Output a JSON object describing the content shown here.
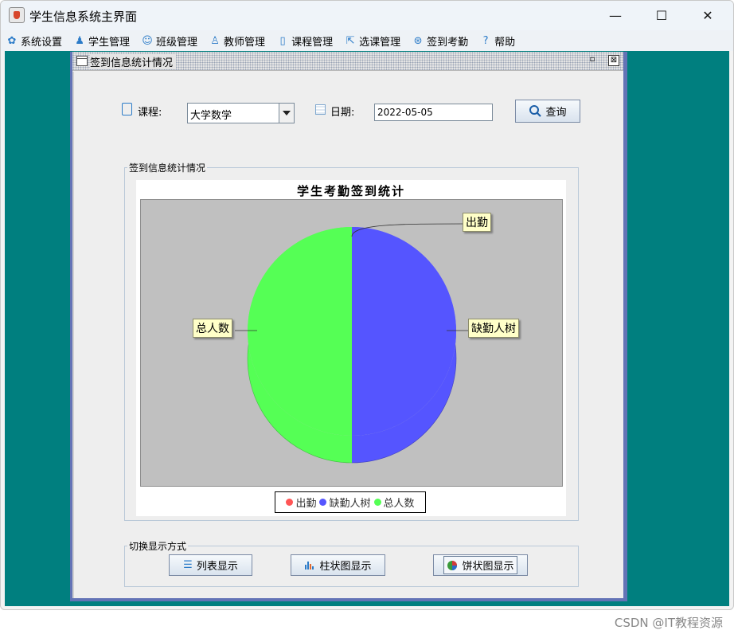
{
  "window": {
    "title": "学生信息系统主界面",
    "minimize_glyph": "—",
    "maximize_glyph": "☐",
    "close_glyph": "✕"
  },
  "menubar": {
    "items": [
      {
        "label": "系统设置",
        "icon": "gear-icon"
      },
      {
        "label": "学生管理",
        "icon": "student-icon"
      },
      {
        "label": "班级管理",
        "icon": "class-group-icon"
      },
      {
        "label": "教师管理",
        "icon": "teacher-icon"
      },
      {
        "label": "课程管理",
        "icon": "book-icon"
      },
      {
        "label": "选课管理",
        "icon": "cursor-select-icon"
      },
      {
        "label": "签到考勤",
        "icon": "checkin-icon"
      },
      {
        "label": "帮助",
        "icon": "help-icon"
      }
    ]
  },
  "internal_frame": {
    "title": "签到信息统计情况"
  },
  "filters": {
    "course_label": "课程:",
    "course_value": "大学数学",
    "date_label": "日期:",
    "date_value": "2022-05-05",
    "query_label": "查询"
  },
  "stats_group": {
    "title": "签到信息统计情况"
  },
  "chart_data": {
    "type": "pie",
    "title": "学生考勤签到统计",
    "labels": [
      "出勤",
      "缺勤人树",
      "总人数"
    ],
    "values": [
      0,
      1,
      1
    ],
    "colors": [
      "#ff5555",
      "#5555ff",
      "#55ff55"
    ],
    "3d": true,
    "legend": "bottom"
  },
  "switch_group": {
    "title": "切换显示方式",
    "list_label": "列表显示",
    "bar_label": "柱状图显示",
    "pie_label": "饼状图显示"
  },
  "watermark": "CSDN @IT教程资源"
}
